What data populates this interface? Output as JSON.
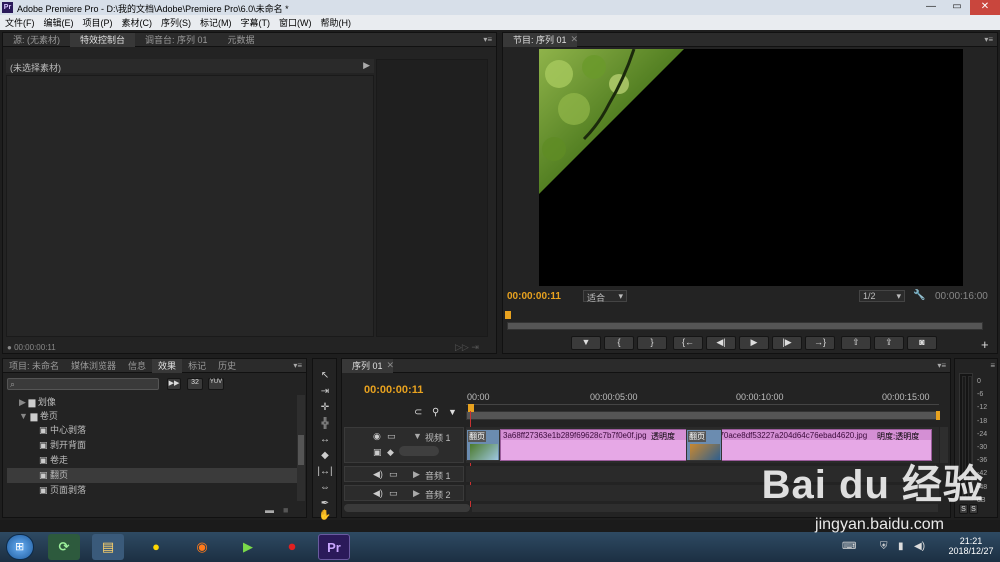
{
  "titlebar": {
    "app_icon": "Pr",
    "title": "Adobe Premiere Pro - D:\\我的文档\\Adobe\\Premiere Pro\\6.0\\未命名 *",
    "minimize": "—",
    "maximize": "▭",
    "close": "✕"
  },
  "menu": [
    "文件(F)",
    "编辑(E)",
    "项目(P)",
    "素材(C)",
    "序列(S)",
    "标记(M)",
    "字幕(T)",
    "窗口(W)",
    "帮助(H)"
  ],
  "top_left_panel": {
    "tabs": [
      "源: (无素材)",
      "特效控制台",
      "调音台: 序列 01",
      "元数据"
    ],
    "active_tab": 1,
    "no_clip_label": "(未选择素材)",
    "timecode": "00:00:00:11"
  },
  "program_monitor": {
    "tab": "节目: 序列 01",
    "timecode_current": "00:00:00:11",
    "fit_dropdown": "适合",
    "resolution": "1/2",
    "timecode_duration": "00:00:16:00"
  },
  "project_panel": {
    "tabs": [
      "项目: 未命名",
      "媒体浏览器",
      "信息",
      "效果",
      "标记",
      "历史"
    ],
    "active_tab": 3,
    "search_placeholder": "",
    "tree": [
      {
        "label": "划像",
        "level": 0,
        "type": "folder",
        "expanded": false
      },
      {
        "label": "卷页",
        "level": 0,
        "type": "folder",
        "expanded": true
      },
      {
        "label": "中心剥落",
        "level": 1,
        "type": "effect"
      },
      {
        "label": "剥开背面",
        "level": 1,
        "type": "effect"
      },
      {
        "label": "卷走",
        "level": 1,
        "type": "effect"
      },
      {
        "label": "翻页",
        "level": 1,
        "type": "effect",
        "selected": true
      },
      {
        "label": "页面剥落",
        "level": 1,
        "type": "effect"
      }
    ],
    "badge_32": "32",
    "badge_yuv": "YUV"
  },
  "timeline": {
    "tab": "序列 01",
    "timecode": "00:00:00:11",
    "ruler": [
      "00:00",
      "00:00:05:00",
      "00:00:10:00",
      "00:00:15:00"
    ],
    "tracks": [
      {
        "name": "视频 1"
      },
      {
        "name": "音频 1"
      },
      {
        "name": "音频 2"
      }
    ],
    "transition_label": "翻页",
    "transition_label_2": "翻页",
    "clip1": {
      "name": "3a68ff27363e1b289f69628c7b7f0e0f.jpg",
      "effect": "透明度"
    },
    "clip2": {
      "name": "370ace8df53227a204d64c76ebad4620.jpg",
      "effect": "明度:透明度"
    }
  },
  "audio_meter": {
    "labels": [
      "0",
      "-6",
      "-12",
      "-18",
      "-24",
      "-30",
      "-36",
      "-42",
      "-48",
      "dB"
    ],
    "solo_left": "S",
    "solo_right": "S"
  },
  "taskbar": {
    "time": "21:21",
    "date": "2018/12/27"
  },
  "watermark": {
    "logo": "Bai du 经验",
    "url": "jingyan.baidu.com"
  }
}
